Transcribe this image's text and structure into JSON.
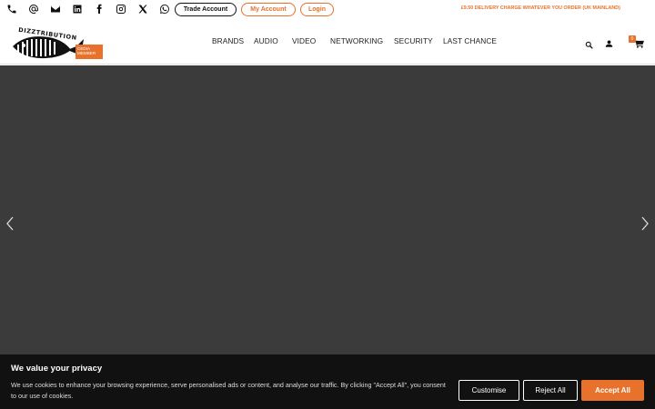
{
  "topbar": {
    "icons": [
      "phone-icon",
      "at-icon",
      "mail-icon",
      "linkedin-icon",
      "facebook-icon",
      "instagram-icon",
      "x-icon",
      "whatsapp-icon"
    ],
    "trade_label": "Trade Account",
    "myaccount_label": "My Account",
    "login_label": "Login",
    "delivery_text": "£9.50 DELIVERY CHARGE WHATEVER YOU ORDER (UK MAINLAND)"
  },
  "header": {
    "logo_text": "DIZZTRIBUTION",
    "cedia_text": "CEDIA MEMBER",
    "nav": [
      "BRANDS",
      "AUDIO",
      "VIDEO",
      "NETWORKING",
      "SECURITY",
      "LAST CHANCE"
    ],
    "cart_count": "0"
  },
  "cookie": {
    "title": "We value your privacy",
    "body": "We use cookies to enhance your browsing experience, serve personalised ads or content, and analyse our traffic. By clicking \"Accept All\", you consent to our use of cookies.",
    "customise": "Customise",
    "reject": "Reject All",
    "accept": "Accept All"
  },
  "colors": {
    "accent": "#e8712b",
    "hero": "#3b3b3b",
    "cookie_bg": "#111111"
  }
}
